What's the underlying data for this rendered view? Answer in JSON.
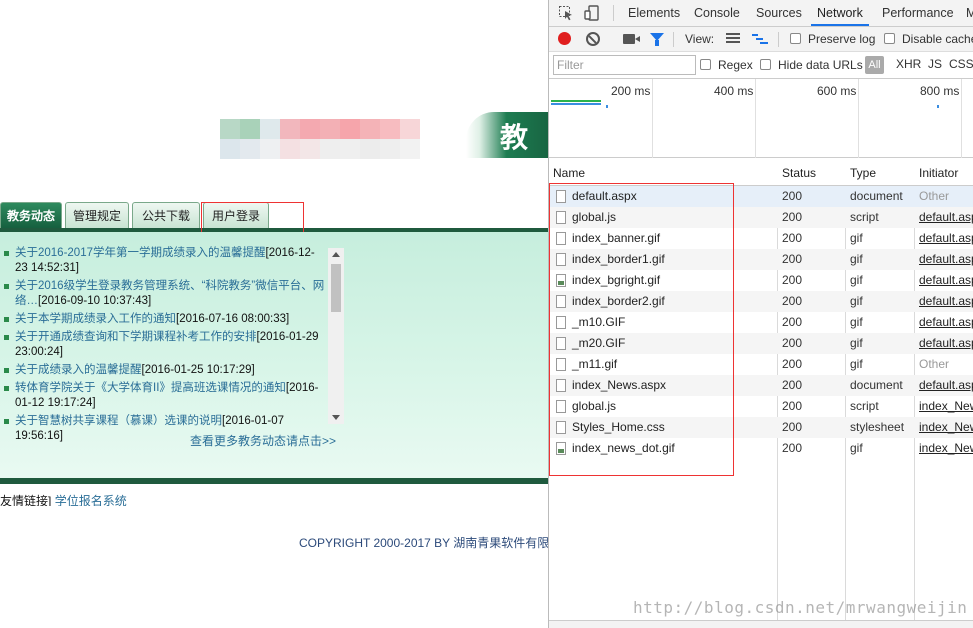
{
  "page": {
    "banner_text": "教务",
    "tabs": [
      {
        "label": "教务动态",
        "active": true
      },
      {
        "label": "管理规定",
        "active": false
      },
      {
        "label": "公共下载",
        "active": false
      },
      {
        "label": "用户登录",
        "active": false
      }
    ],
    "news": [
      {
        "title": "关于2016-2017学年第一学期成绩录入的温馨提醒",
        "date": "[2016-12-23 14:52:31]"
      },
      {
        "title": "关于2016级学生登录教务管理系统、“科院教务”微信平台、网络…",
        "date": "[2016-09-10 10:37:43]"
      },
      {
        "title": "关于本学期成绩录入工作的通知",
        "date": "[2016-07-16 08:00:33]"
      },
      {
        "title": "关于开通成绩查询和下学期课程补考工作的安排",
        "date": "[2016-01-29 23:00:24]"
      },
      {
        "title": "关于成绩录入的温馨提醒",
        "date": "[2016-01-25 10:17:29]"
      },
      {
        "title": "转体育学院关于《大学体育II》提高班选课情况的通知",
        "date": "[2016-01-12 19:17:24]"
      },
      {
        "title": "关于智慧树共享课程（慕课）选课的说明",
        "date": "[2016-01-07 19:56:16]"
      }
    ],
    "more_link": "查看更多教务动态请点击>>",
    "friend_links_label": "友情链接]",
    "friend_link": "学位报名系统",
    "copyright": "COPYRIGHT 2000-2017 BY 湖南青果软件有限"
  },
  "devtools": {
    "tabs": [
      "Elements",
      "Console",
      "Sources",
      "Network",
      "Performance",
      "M"
    ],
    "active_tab": "Network",
    "toolbar": {
      "view_label": "View:",
      "preserve_log": "Preserve log",
      "disable_cache": "Disable cache"
    },
    "filter": {
      "placeholder": "Filter",
      "regex": "Regex",
      "hide_data_urls": "Hide data URLs",
      "types": [
        "All",
        "XHR",
        "JS",
        "CSS"
      ]
    },
    "overview_ticks": [
      "200 ms",
      "400 ms",
      "600 ms",
      "800 ms"
    ],
    "columns": [
      "Name",
      "Status",
      "Type",
      "Initiator"
    ],
    "rows": [
      {
        "name": "default.aspx",
        "status": "200",
        "type": "document",
        "initiator": "Other"
      },
      {
        "name": "global.js",
        "status": "200",
        "type": "script",
        "initiator": "default.aspx"
      },
      {
        "name": "index_banner.gif",
        "status": "200",
        "type": "gif",
        "initiator": "default.aspx"
      },
      {
        "name": "index_border1.gif",
        "status": "200",
        "type": "gif",
        "initiator": "default.aspx"
      },
      {
        "name": "index_bgright.gif",
        "status": "200",
        "type": "gif",
        "initiator": "default.aspx"
      },
      {
        "name": "index_border2.gif",
        "status": "200",
        "type": "gif",
        "initiator": "default.aspx"
      },
      {
        "name": "_m10.GIF",
        "status": "200",
        "type": "gif",
        "initiator": "default.aspx"
      },
      {
        "name": "_m20.GIF",
        "status": "200",
        "type": "gif",
        "initiator": "default.aspx"
      },
      {
        "name": "_m11.gif",
        "status": "200",
        "type": "gif",
        "initiator": "Other"
      },
      {
        "name": "index_News.aspx",
        "status": "200",
        "type": "document",
        "initiator": "default.aspx"
      },
      {
        "name": "global.js",
        "status": "200",
        "type": "script",
        "initiator": "index_News"
      },
      {
        "name": "Styles_Home.css",
        "status": "200",
        "type": "stylesheet",
        "initiator": "index_News"
      },
      {
        "name": "index_news_dot.gif",
        "status": "200",
        "type": "gif",
        "initiator": "index_News"
      }
    ]
  },
  "watermark": "http://blog.csdn.net/mrwangweijin",
  "colors": {
    "accent_blue": "#1a73e8",
    "record_red": "#e01e1e",
    "page_green": "#1f5a3e",
    "highlight_red": "#ee3333"
  }
}
